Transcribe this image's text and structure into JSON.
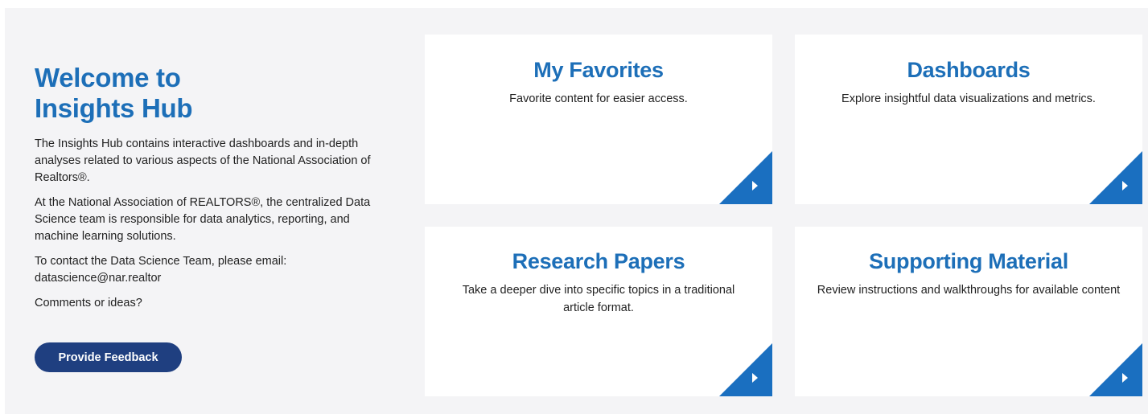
{
  "welcome": {
    "title": "Welcome to Insights Hub",
    "paragraphs": [
      "The Insights Hub contains interactive dashboards and in-depth analyses related to various aspects of the National Association of Realtors®.",
      "At the National Association of REALTORS®, the centralized Data Science team is responsible for data analytics, reporting, and machine learning solutions.",
      "To contact the Data Science Team, please email: datascience@nar.realtor",
      "Comments or ideas?"
    ],
    "feedback_button": "Provide Feedback"
  },
  "cards": [
    {
      "title": "My Favorites",
      "description": "Favorite content for easier access.",
      "icon": "play-arrow-icon"
    },
    {
      "title": "Dashboards",
      "description": "Explore insightful data visualizations and metrics.",
      "icon": "play-arrow-icon"
    },
    {
      "title": "Research Papers",
      "description": "Take a deeper dive into specific topics in a traditional article format.",
      "icon": "play-arrow-icon"
    },
    {
      "title": "Supporting Material",
      "description": "Review instructions and walkthroughs for available content",
      "icon": "play-arrow-icon"
    }
  ],
  "colors": {
    "heading_blue": "#1d6fb8",
    "button_navy": "#1f3f80",
    "corner_blue": "#1a6fc0",
    "panel_bg": "#f4f4f6"
  }
}
